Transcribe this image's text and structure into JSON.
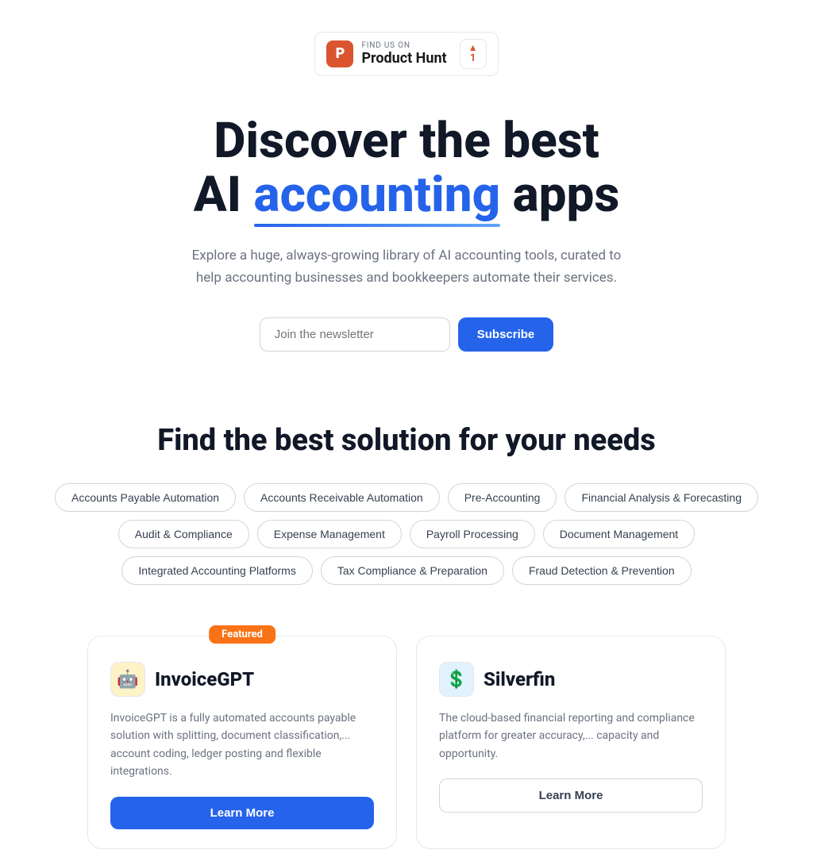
{
  "product_hunt": {
    "find_us_label": "FIND US ON",
    "name": "Product Hunt",
    "logo_letter": "P",
    "vote_count": "1",
    "arrow": "▲"
  },
  "hero": {
    "line1": "Discover the best",
    "line2_pre": "AI ",
    "line2_accent": "accounting",
    "line2_post": " apps",
    "subtitle": "Explore a huge, always-growing library of AI accounting tools, curated to help accounting businesses and bookkeepers automate their services."
  },
  "newsletter": {
    "placeholder": "Join the newsletter",
    "subscribe_label": "Subscribe"
  },
  "find_section": {
    "title": "Find the best solution for your needs"
  },
  "tags": [
    "Accounts Payable Automation",
    "Accounts Receivable Automation",
    "Pre-Accounting",
    "Financial Analysis & Forecasting",
    "Audit & Compliance",
    "Expense Management",
    "Payroll Processing",
    "Document Management",
    "Integrated Accounting Platforms",
    "Tax Compliance & Preparation",
    "Fraud Detection & Prevention"
  ],
  "cards": [
    {
      "featured": true,
      "featured_label": "Featured",
      "logo_emoji": "🤖",
      "name": "InvoiceGPT",
      "description": "InvoiceGPT is a fully automated accounts payable solution with splitting, document classification,... account coding, ledger posting and flexible integrations.",
      "cta": "Learn More",
      "cta_style": "primary"
    },
    {
      "featured": false,
      "featured_label": "",
      "logo_emoji": "💲",
      "name": "Silverfin",
      "description": "The cloud-based financial reporting and compliance platform for greater accuracy,... capacity and opportunity.",
      "cta": "Learn More",
      "cta_style": "outline"
    }
  ],
  "colors": {
    "accent": "#2563eb",
    "orange": "#f97316",
    "ph_red": "#da552f"
  }
}
